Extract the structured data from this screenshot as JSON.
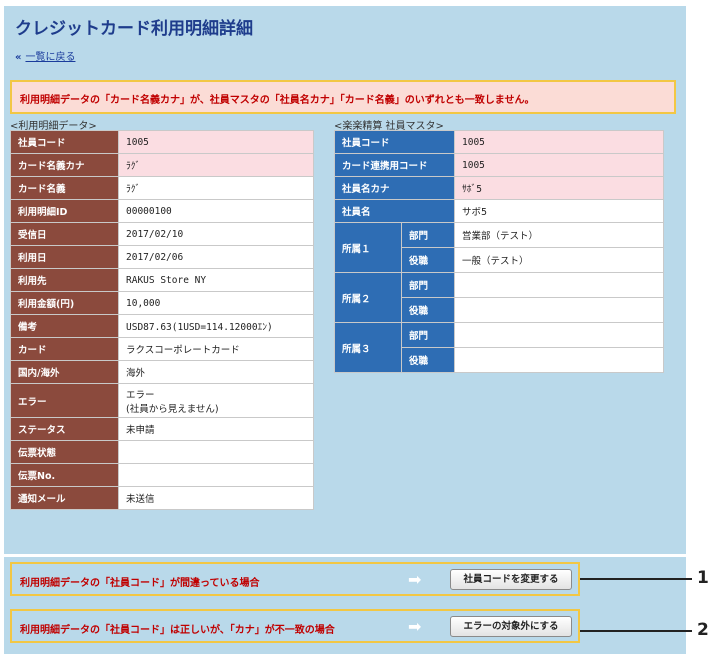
{
  "page": {
    "title": "クレジットカード利用明細詳細",
    "back_chevron": "«",
    "back_link": "一覧に戻る"
  },
  "error_message": "利用明細データの「カード名義カナ」が、社員マスタの「社員名カナ」「カード名義」のいずれとも一致しません。",
  "left_table": {
    "label": "<利用明細データ>",
    "rows": [
      {
        "header": "社員コード",
        "value": "1005"
      },
      {
        "header": "カード名義カナ",
        "value": "ﾗｸﾞ"
      },
      {
        "header": "カード名義",
        "value": "ﾗｸﾞ"
      },
      {
        "header": "利用明細ID",
        "value": "00000100"
      },
      {
        "header": "受信日",
        "value": "2017/02/10"
      },
      {
        "header": "利用日",
        "value": "2017/02/06"
      },
      {
        "header": "利用先",
        "value": "RAKUS Store NY"
      },
      {
        "header": "利用金額(円)",
        "value": "10,000"
      },
      {
        "header": "備考",
        "value": "USD87.63(1USD=114.12000ｴﾝ)"
      },
      {
        "header": "カード",
        "value": "ラクスコーポレートカード"
      },
      {
        "header": "国内/海外",
        "value": "海外"
      },
      {
        "header": "エラー",
        "value": "エラー",
        "value2": "(社員から見えません)"
      },
      {
        "header": "ステータス",
        "value": "未申請"
      },
      {
        "header": "伝票状態",
        "value": ""
      },
      {
        "header": "伝票No.",
        "value": ""
      },
      {
        "header": "通知メール",
        "value": "未送信"
      }
    ]
  },
  "right_table": {
    "label": "<楽楽精算 社員マスタ>",
    "rows": [
      {
        "header": "社員コード",
        "value": "1005"
      },
      {
        "header": "カード連携用コード",
        "value": "1005"
      },
      {
        "header": "社員名カナ",
        "value": "ｻﾎﾞ5"
      },
      {
        "header": "社員名",
        "value": "サボ5"
      }
    ],
    "affiliations": [
      {
        "group": "所属１",
        "dept_label": "部門",
        "dept": "営業部（テスト）",
        "role_label": "役職",
        "role": "一般（テスト）"
      },
      {
        "group": "所属２",
        "dept_label": "部門",
        "dept": "",
        "role_label": "役職",
        "role": ""
      },
      {
        "group": "所属３",
        "dept_label": "部門",
        "dept": "",
        "role_label": "役職",
        "role": ""
      }
    ]
  },
  "actions": [
    {
      "text": "利用明細データの「社員コード」が間違っている場合",
      "arrow": "➡",
      "button": "社員コードを変更する",
      "callout": "1"
    },
    {
      "text": "利用明細データの「社員コード」は正しいが、「カナ」が不一致の場合",
      "arrow": "➡",
      "button": "エラーの対象外にする",
      "callout": "2"
    }
  ]
}
